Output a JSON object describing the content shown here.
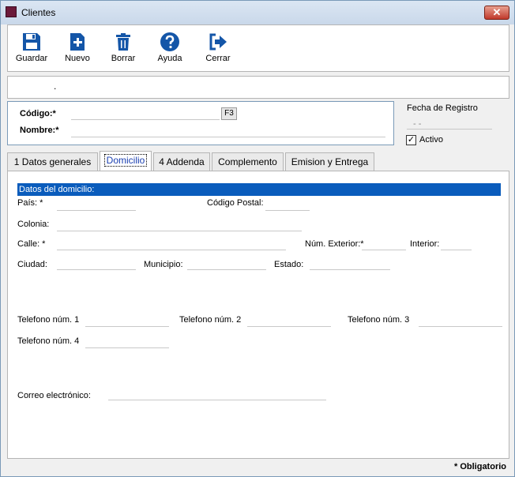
{
  "window": {
    "title": "Clientes",
    "close_glyph": "✕"
  },
  "toolbar": {
    "buttons": [
      {
        "label": "Guardar",
        "icon": "save-icon"
      },
      {
        "label": "Nuevo",
        "icon": "new-document-icon"
      },
      {
        "label": "Borrar",
        "icon": "trash-icon"
      },
      {
        "label": "Ayuda",
        "icon": "help-icon"
      },
      {
        "label": "Cerrar",
        "icon": "exit-icon"
      }
    ]
  },
  "infobar": {
    "text": "."
  },
  "identity": {
    "codigo_label": "Código:*",
    "codigo_value": "",
    "f3_label": "F3",
    "nombre_label": "Nombre:*",
    "nombre_value": ""
  },
  "side": {
    "fecha_label": "Fecha de Registro",
    "fecha_value": "- -",
    "activo_label": "Activo",
    "activo_checked": true,
    "check_glyph": "✓"
  },
  "tabs": [
    {
      "label": "1 Datos generales",
      "active": false
    },
    {
      "label": "Domicilio",
      "active": true
    },
    {
      "label": "4 Addenda",
      "active": false
    },
    {
      "label": "Complemento",
      "active": false
    },
    {
      "label": "Emision y Entrega",
      "active": false
    }
  ],
  "domicilio": {
    "section_title": "Datos del domicilio:",
    "pais_label": "País: *",
    "codigo_postal_label": "Código Postal:",
    "colonia_label": "Colonia:",
    "calle_label": "Calle: *",
    "num_exterior_label": "Núm. Exterior:*",
    "interior_label": "Interior:",
    "ciudad_label": "Ciudad:",
    "municipio_label": "Municipio:",
    "estado_label": "Estado:",
    "tel1_label": "Telefono núm. 1",
    "tel2_label": "Telefono núm. 2",
    "tel3_label": "Telefono núm. 3",
    "tel4_label": "Telefono núm. 4",
    "correo_label": "Correo electrónico:"
  },
  "status": {
    "obligatorio": "* Obligatorio"
  }
}
